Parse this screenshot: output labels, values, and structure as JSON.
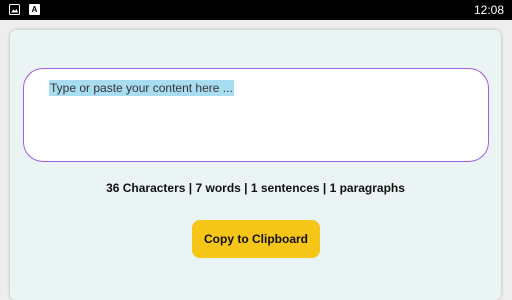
{
  "status_bar": {
    "time": "12:08",
    "icons": [
      "image-icon",
      "text-a-icon"
    ],
    "text_icon_glyph": "A"
  },
  "editor": {
    "placeholder": "Type or paste your content here ..."
  },
  "stats": {
    "text": "36 Characters | 7 words | 1 sentences | 1 paragraphs"
  },
  "actions": {
    "copy_label": "Copy to Clipboard"
  },
  "colors": {
    "status_bar": "#000000",
    "card_background": "#eaf4f4",
    "editor_border": "#a35ee0",
    "selection_highlight": "#a8dcf0",
    "button_accent": "#f5c518"
  }
}
